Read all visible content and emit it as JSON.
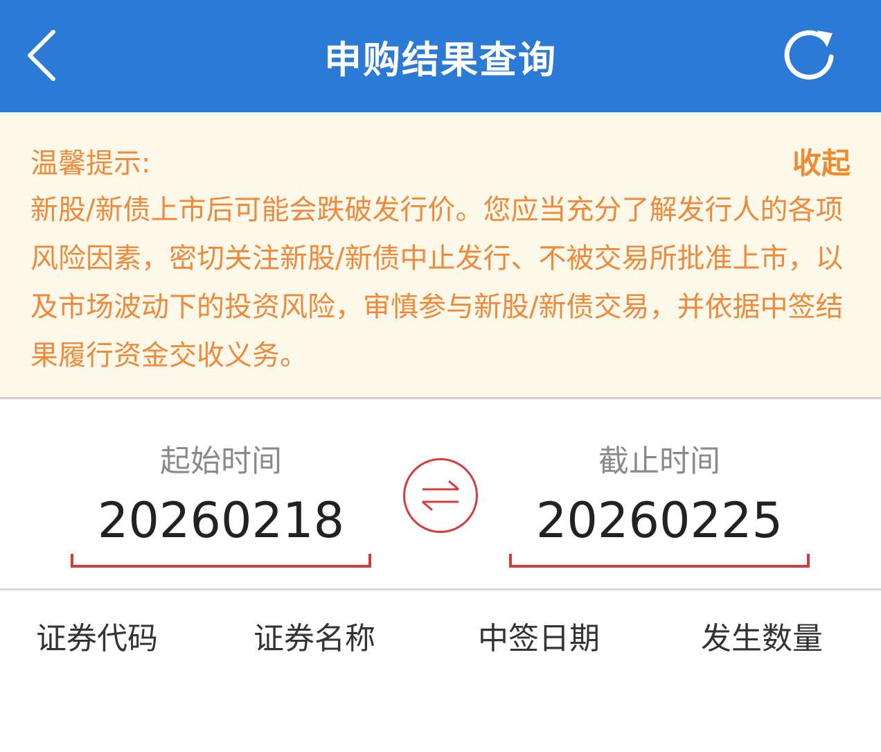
{
  "header": {
    "title": "申购结果查询",
    "back_icon": "chevron-left-icon",
    "refresh_icon": "refresh-icon"
  },
  "notice": {
    "label": "温馨提示:",
    "collapse_label": "收起",
    "text": "新股/新债上市后可能会跌破发行价。您应当充分了解发行人的各项风险因素，密切关注新股/新债中止发行、不被交易所批准上市，以及市场波动下的投资风险，审慎参与新股/新债交易，并依据中签结果履行资金交收义务。"
  },
  "date_range": {
    "start_label": "起始时间",
    "start_value": "20260218",
    "end_label": "截止时间",
    "end_value": "20260225",
    "swap_icon": "swap-arrows-icon"
  },
  "table": {
    "columns": [
      "证券代码",
      "证券名称",
      "中签日期",
      "发生数量"
    ]
  },
  "colors": {
    "header_bg": "#2b7bd6",
    "notice_bg": "#fdf9ea",
    "notice_text": "#f0893a",
    "accent_red": "#d63a3f"
  }
}
